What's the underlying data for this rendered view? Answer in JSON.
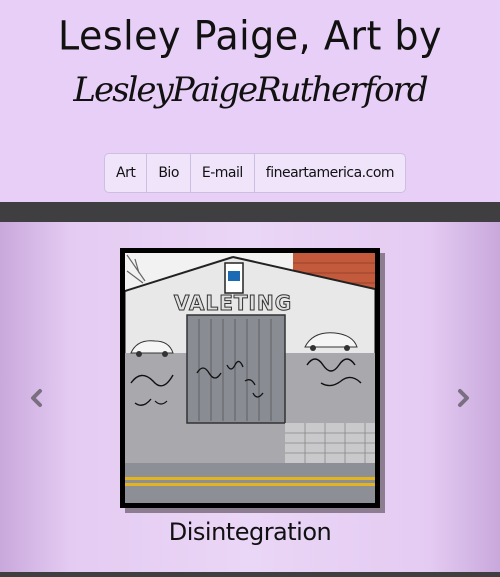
{
  "header": {
    "title": "Lesley Paige, Art by",
    "signature": "LesleyPaigeRutherford"
  },
  "nav": {
    "items": [
      {
        "label": "Art"
      },
      {
        "label": "Bio"
      },
      {
        "label": "E-mail"
      },
      {
        "label": "fineartamerica.com"
      }
    ]
  },
  "carousel": {
    "prev_icon": "chevron-left-icon",
    "next_icon": "chevron-right-icon",
    "painting": {
      "sign_text": "VALETING",
      "caption": "Disintegration"
    }
  },
  "colors": {
    "background": "#e8cff7",
    "dark_bar": "#3f3e40",
    "arrow": "#7a6f80"
  }
}
